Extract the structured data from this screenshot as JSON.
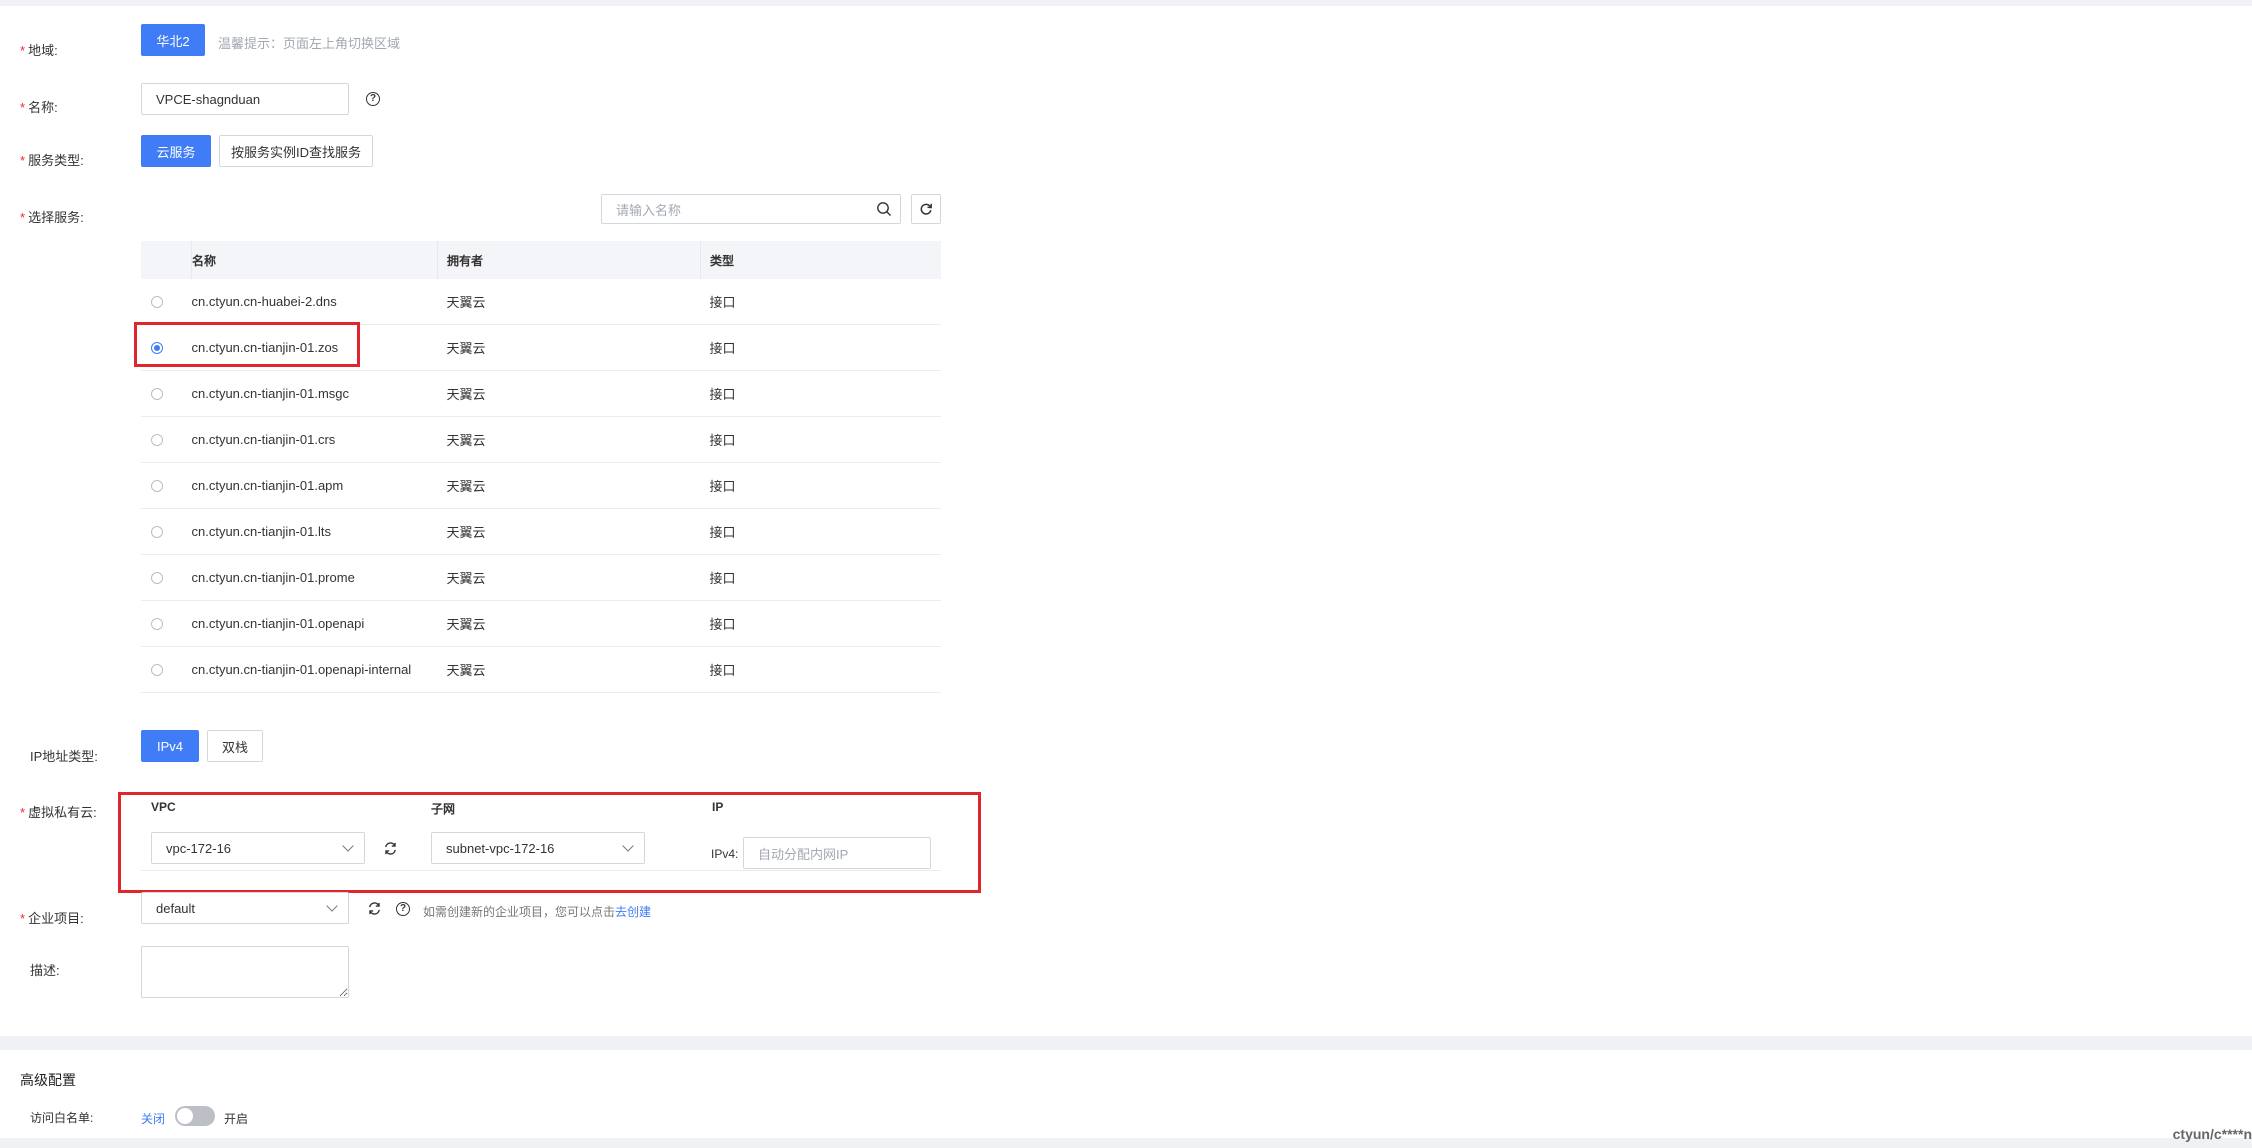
{
  "form": {
    "region": {
      "label": "地域:",
      "button": "华北2",
      "hint": "温馨提示：页面左上角切换区域"
    },
    "name": {
      "label": "名称:",
      "value": "VPCE-shagnduan"
    },
    "service_type": {
      "label": "服务类型:",
      "options": [
        "云服务",
        "按服务实例ID查找服务"
      ],
      "selected": "云服务"
    },
    "select_service": {
      "label": "选择服务:",
      "search_placeholder": "请输入名称",
      "columns": [
        "名称",
        "拥有者",
        "类型"
      ],
      "rows": [
        {
          "name": "cn.ctyun.cn-huabei-2.dns",
          "owner": "天翼云",
          "type": "接口",
          "selected": false
        },
        {
          "name": "cn.ctyun.cn-tianjin-01.zos",
          "owner": "天翼云",
          "type": "接口",
          "selected": true
        },
        {
          "name": "cn.ctyun.cn-tianjin-01.msgc",
          "owner": "天翼云",
          "type": "接口",
          "selected": false
        },
        {
          "name": "cn.ctyun.cn-tianjin-01.crs",
          "owner": "天翼云",
          "type": "接口",
          "selected": false
        },
        {
          "name": "cn.ctyun.cn-tianjin-01.apm",
          "owner": "天翼云",
          "type": "接口",
          "selected": false
        },
        {
          "name": "cn.ctyun.cn-tianjin-01.lts",
          "owner": "天翼云",
          "type": "接口",
          "selected": false
        },
        {
          "name": "cn.ctyun.cn-tianjin-01.prome",
          "owner": "天翼云",
          "type": "接口",
          "selected": false
        },
        {
          "name": "cn.ctyun.cn-tianjin-01.openapi",
          "owner": "天翼云",
          "type": "接口",
          "selected": false
        },
        {
          "name": "cn.ctyun.cn-tianjin-01.openapi-internal",
          "owner": "天翼云",
          "type": "接口",
          "selected": false
        }
      ]
    },
    "ip_type": {
      "label": "IP地址类型:",
      "options": [
        "IPv4",
        "双栈"
      ],
      "selected": "IPv4"
    },
    "vpc": {
      "label": "虚拟私有云:",
      "col_vpc": "VPC",
      "col_subnet": "子网",
      "col_ip": "IP",
      "vpc_value": "vpc-172-16",
      "subnet_value": "subnet-vpc-172-16",
      "ipv4_label": "IPv4:",
      "ip_placeholder": "自动分配内网IP"
    },
    "enterprise": {
      "label": "企业项目:",
      "value": "default",
      "hint": "如需创建新的企业项目，您可以点击",
      "link": "去创建"
    },
    "description": {
      "label": "描述:"
    }
  },
  "advanced": {
    "title": "高级配置",
    "whitelist": {
      "label": "访问白名单:",
      "off": "关闭",
      "on": "开启",
      "enabled": false
    }
  },
  "footer": {
    "user": "ctyun/c****n"
  }
}
